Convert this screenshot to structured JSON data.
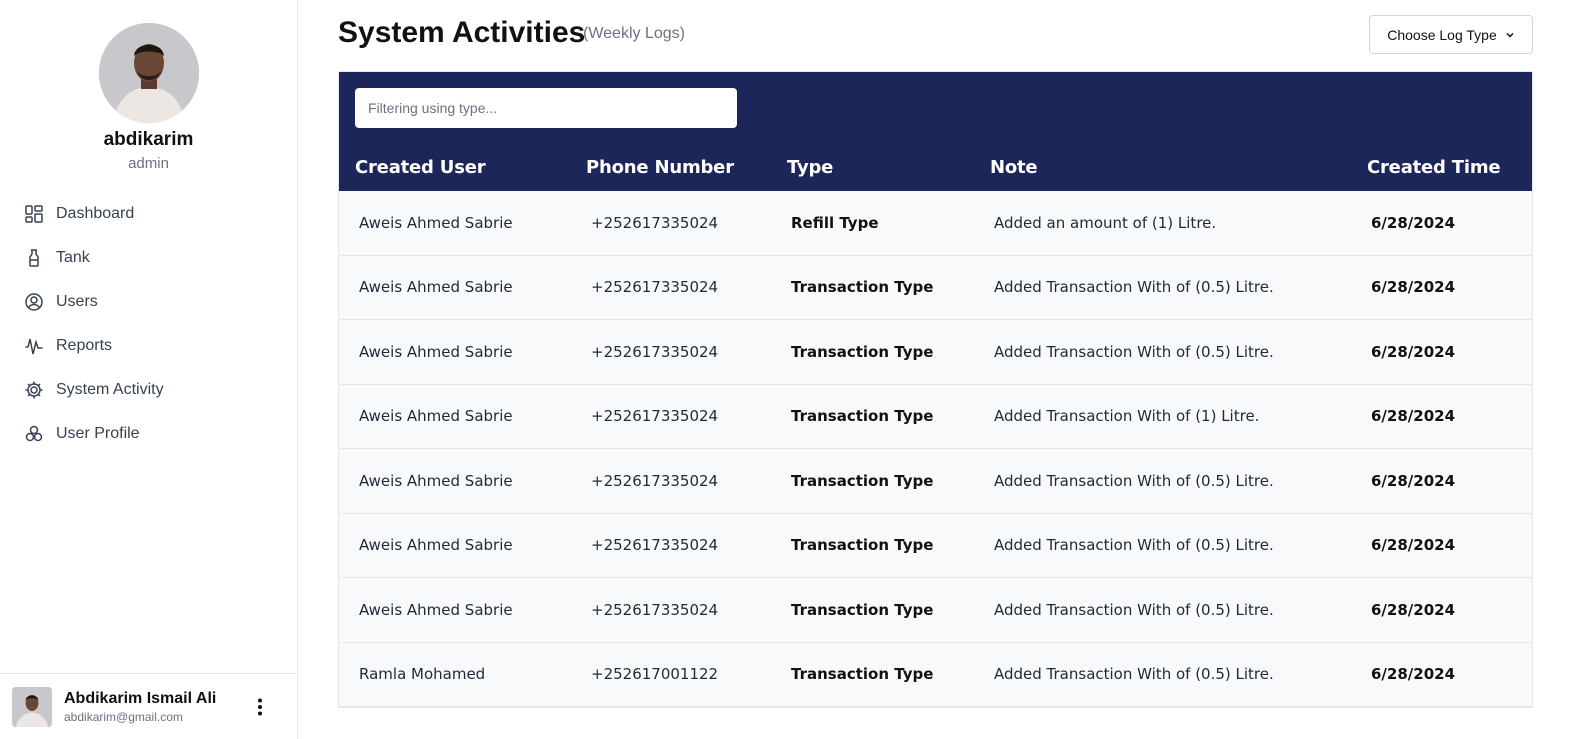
{
  "profile": {
    "name": "abdikarim",
    "role": "admin"
  },
  "nav": {
    "dashboard": "Dashboard",
    "tank": "Tank",
    "users": "Users",
    "reports": "Reports",
    "system_activity": "System Activity",
    "user_profile": "User Profile"
  },
  "footer": {
    "name": "Abdikarim Ismail Ali",
    "email": "abdikarim@gmail.com"
  },
  "header": {
    "title": "System Activities",
    "subtitle": "(Weekly Logs)",
    "select_label": "Choose Log Type"
  },
  "filter": {
    "placeholder": "Filtering using type..."
  },
  "table": {
    "columns": [
      "Created User",
      "Phone Number",
      "Type",
      "Note",
      "Created Time"
    ],
    "rows": [
      [
        "Aweis Ahmed Sabrie",
        "+252617335024",
        "Refill Type",
        "Added an amount of (1) Litre.",
        "6/28/2024"
      ],
      [
        "Aweis Ahmed Sabrie",
        "+252617335024",
        "Transaction Type",
        "Added Transaction With of (0.5) Litre.",
        "6/28/2024"
      ],
      [
        "Aweis Ahmed Sabrie",
        "+252617335024",
        "Transaction Type",
        "Added Transaction With of (0.5) Litre.",
        "6/28/2024"
      ],
      [
        "Aweis Ahmed Sabrie",
        "+252617335024",
        "Transaction Type",
        "Added Transaction With of (1) Litre.",
        "6/28/2024"
      ],
      [
        "Aweis Ahmed Sabrie",
        "+252617335024",
        "Transaction Type",
        "Added Transaction With of (0.5) Litre.",
        "6/28/2024"
      ],
      [
        "Aweis Ahmed Sabrie",
        "+252617335024",
        "Transaction Type",
        "Added Transaction With of (0.5) Litre.",
        "6/28/2024"
      ],
      [
        "Aweis Ahmed Sabrie",
        "+252617335024",
        "Transaction Type",
        "Added Transaction With of (0.5) Litre.",
        "6/28/2024"
      ],
      [
        "Ramla Mohamed",
        "+252617001122",
        "Transaction Type",
        "Added Transaction With of (0.5) Litre.",
        "6/28/2024"
      ]
    ]
  },
  "colors": {
    "table_header": "#1c2659",
    "row_bg": "#f8f9fb",
    "accent_text": "#111111"
  },
  "icons": [
    "dashboard-icon",
    "tank-icon",
    "users-icon",
    "reports-icon",
    "system-activity-icon",
    "user-profile-icon",
    "chevron-down-icon",
    "kebab-menu-icon"
  ]
}
